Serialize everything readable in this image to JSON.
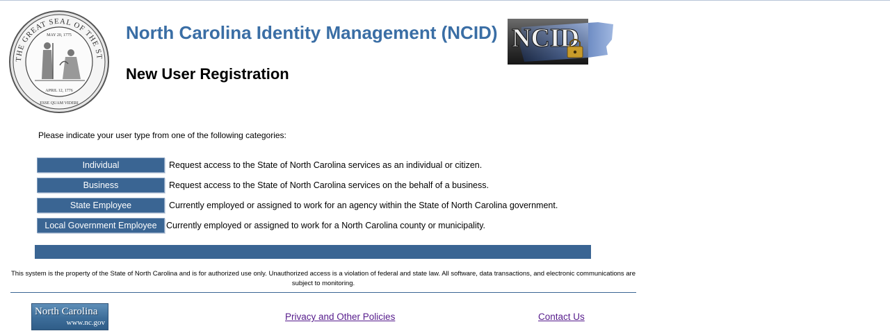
{
  "header": {
    "title": "North Carolina Identity Management (NCID)",
    "subtitle": "New User Registration",
    "seal": {
      "outer_text": "THE GREAT SEAL OF THE STATE OF NORTH CAROLINA",
      "date_top": "MAY 20, 1775",
      "date_bottom": "APRIL 12, 1776",
      "motto": "ESSE QUAM VIDERI"
    },
    "ncid_logo_text": "NCID"
  },
  "registration": {
    "prompt": "Please indicate your user type from one of the following categories:",
    "user_types": [
      {
        "label": "Individual",
        "description": "Request access to the State of North Carolina services as an individual or citizen."
      },
      {
        "label": "Business",
        "description": "Request access to the State of North Carolina services on the behalf of a business."
      },
      {
        "label": "State Employee",
        "description": "Currently employed or assigned to work for an agency within the State of North Carolina government."
      },
      {
        "label": "Local Government Employee",
        "description": "Currently employed or assigned to work for a North Carolina county or municipality."
      }
    ]
  },
  "footer": {
    "disclaimer": "This system is the property of the State of North Carolina and is for authorized use only. Unauthorized access is a violation of federal and state law. All software, data transactions, and electronic communications are subject to monitoring.",
    "nc_logo": {
      "line1": "North Carolina",
      "line2": "www.nc.gov"
    },
    "privacy_link": "Privacy and Other Policies",
    "contact_link": "Contact Us"
  },
  "colors": {
    "title": "#3a6ea5",
    "button_bg": "#3a6593",
    "link": "#551a8b"
  }
}
